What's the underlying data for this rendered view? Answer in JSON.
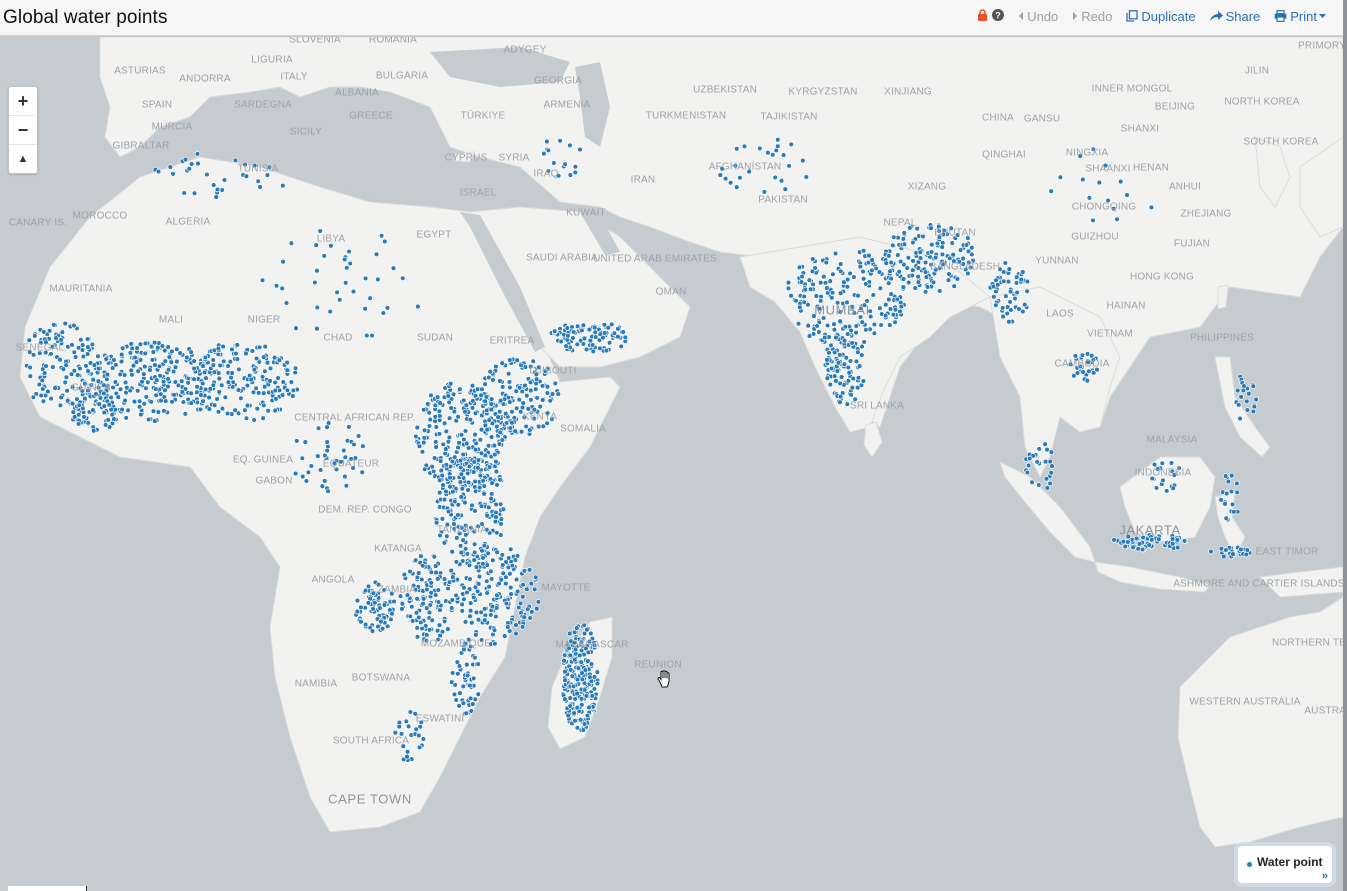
{
  "header": {
    "title": "Global water points",
    "undo_label": "Undo",
    "redo_label": "Redo",
    "duplicate_label": "Duplicate",
    "share_label": "Share",
    "print_label": "Print"
  },
  "colors": {
    "accent": "#2c6fb6",
    "lock": "#e8532b",
    "point": "#2b7bb9",
    "water": "#c5cbcf",
    "land": "#f2f2f1"
  },
  "zoom": {
    "in_label": "+",
    "out_label": "−",
    "north_label": "▲"
  },
  "legend": {
    "series_label": "Water point",
    "expand_label": "»"
  },
  "map_labels": [
    "SLOVENIA",
    "ROMANIA",
    "ADYGEY",
    "ASTURIAS",
    "ANDORRA",
    "LIGURIA",
    "ITALY",
    "BULGARIA",
    "GEORGIA",
    "UZBEKISTAN",
    "KYRGYZSTAN",
    "XINJIANG",
    "INNER MONGOL",
    "JILIN",
    "PRIMORY",
    "SPAIN",
    "SARDEGNA",
    "ALBANIA",
    "ARMENIA",
    "NORTH KOREA",
    "BEIJING",
    "MURCIA",
    "GREECE",
    "TÜRKIYE",
    "TURKMENISTAN",
    "TAJIKISTAN",
    "CHINA",
    "GANSU",
    "SHANXI",
    "SOUTH KOREA",
    "GIBRALTAR",
    "SICILY",
    "CYPRUS",
    "SYRIA",
    "AFGHANISTAN",
    "QINGHAI",
    "NINGXIA",
    "TUNISIA",
    "IRAQ",
    "SHAANXI",
    "HENAN",
    "ANHUI",
    "IRAN",
    "XIZANG",
    "ISRAEL",
    "PAKISTAN",
    "MOROCCO",
    "ALGERIA",
    "KUWAIT",
    "CHONGQING",
    "ZHEJIANG",
    "CANARY IS.",
    "EGYPT",
    "LIBYA",
    "BHUTAN",
    "GUIZHOU",
    "FUJIAN",
    "SAUDI ARABIA",
    "UNITED ARAB EMIRATES",
    "YUNNAN",
    "HONG KONG",
    "MAURITANIA",
    "OMAN",
    "NEPAL",
    "BANGLADESH",
    "HAINAN",
    "MALI",
    "NIGER",
    "CHAD",
    "SUDAN",
    "ERITREA",
    "MUMBAI",
    "LAOS",
    "VIETNAM",
    "PHILIPPINES",
    "SENEGAL",
    "GUINEA",
    "DJIBOUTI",
    "CAMBODIA",
    "SRI LANKA",
    "CENTRAL AFRICAN REP.",
    "SOMALIA",
    "MALAYSIA",
    "EQ. GUINEA",
    "EQUATEUR",
    "GABON",
    "INDONESIA",
    "DEM. REP. CONGO",
    "TANZANIA",
    "JAKARTA",
    "KATANGA",
    "EAST TIMOR",
    "ANGOLA",
    "ZAMBIA",
    "MAYOTTE",
    "ASHMORE AND CARTIER ISLANDS",
    "MOZAMBIQUE",
    "MADAGASCAR",
    "REUNION",
    "NAMIBIA",
    "BOTSWANA",
    "NORTHERN TERRITORY",
    "WESTERN AUSTRALIA",
    "ESWATINI",
    "SOUTH AFRICA",
    "AUSTRALIA",
    "CAPE TOWN",
    "KENYA"
  ]
}
